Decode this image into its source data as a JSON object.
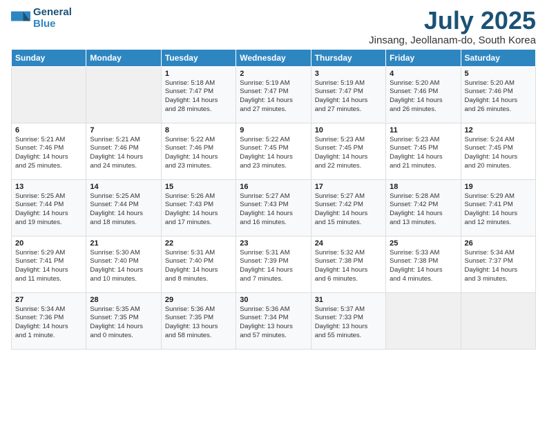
{
  "header": {
    "logo_line1": "General",
    "logo_line2": "Blue",
    "month_title": "July 2025",
    "location": "Jinsang, Jeollanam-do, South Korea"
  },
  "weekdays": [
    "Sunday",
    "Monday",
    "Tuesday",
    "Wednesday",
    "Thursday",
    "Friday",
    "Saturday"
  ],
  "weeks": [
    [
      {
        "day": "",
        "info": ""
      },
      {
        "day": "",
        "info": ""
      },
      {
        "day": "1",
        "info": "Sunrise: 5:18 AM\nSunset: 7:47 PM\nDaylight: 14 hours\nand 28 minutes."
      },
      {
        "day": "2",
        "info": "Sunrise: 5:19 AM\nSunset: 7:47 PM\nDaylight: 14 hours\nand 27 minutes."
      },
      {
        "day": "3",
        "info": "Sunrise: 5:19 AM\nSunset: 7:47 PM\nDaylight: 14 hours\nand 27 minutes."
      },
      {
        "day": "4",
        "info": "Sunrise: 5:20 AM\nSunset: 7:46 PM\nDaylight: 14 hours\nand 26 minutes."
      },
      {
        "day": "5",
        "info": "Sunrise: 5:20 AM\nSunset: 7:46 PM\nDaylight: 14 hours\nand 26 minutes."
      }
    ],
    [
      {
        "day": "6",
        "info": "Sunrise: 5:21 AM\nSunset: 7:46 PM\nDaylight: 14 hours\nand 25 minutes."
      },
      {
        "day": "7",
        "info": "Sunrise: 5:21 AM\nSunset: 7:46 PM\nDaylight: 14 hours\nand 24 minutes."
      },
      {
        "day": "8",
        "info": "Sunrise: 5:22 AM\nSunset: 7:46 PM\nDaylight: 14 hours\nand 23 minutes."
      },
      {
        "day": "9",
        "info": "Sunrise: 5:22 AM\nSunset: 7:45 PM\nDaylight: 14 hours\nand 23 minutes."
      },
      {
        "day": "10",
        "info": "Sunrise: 5:23 AM\nSunset: 7:45 PM\nDaylight: 14 hours\nand 22 minutes."
      },
      {
        "day": "11",
        "info": "Sunrise: 5:23 AM\nSunset: 7:45 PM\nDaylight: 14 hours\nand 21 minutes."
      },
      {
        "day": "12",
        "info": "Sunrise: 5:24 AM\nSunset: 7:45 PM\nDaylight: 14 hours\nand 20 minutes."
      }
    ],
    [
      {
        "day": "13",
        "info": "Sunrise: 5:25 AM\nSunset: 7:44 PM\nDaylight: 14 hours\nand 19 minutes."
      },
      {
        "day": "14",
        "info": "Sunrise: 5:25 AM\nSunset: 7:44 PM\nDaylight: 14 hours\nand 18 minutes."
      },
      {
        "day": "15",
        "info": "Sunrise: 5:26 AM\nSunset: 7:43 PM\nDaylight: 14 hours\nand 17 minutes."
      },
      {
        "day": "16",
        "info": "Sunrise: 5:27 AM\nSunset: 7:43 PM\nDaylight: 14 hours\nand 16 minutes."
      },
      {
        "day": "17",
        "info": "Sunrise: 5:27 AM\nSunset: 7:42 PM\nDaylight: 14 hours\nand 15 minutes."
      },
      {
        "day": "18",
        "info": "Sunrise: 5:28 AM\nSunset: 7:42 PM\nDaylight: 14 hours\nand 13 minutes."
      },
      {
        "day": "19",
        "info": "Sunrise: 5:29 AM\nSunset: 7:41 PM\nDaylight: 14 hours\nand 12 minutes."
      }
    ],
    [
      {
        "day": "20",
        "info": "Sunrise: 5:29 AM\nSunset: 7:41 PM\nDaylight: 14 hours\nand 11 minutes."
      },
      {
        "day": "21",
        "info": "Sunrise: 5:30 AM\nSunset: 7:40 PM\nDaylight: 14 hours\nand 10 minutes."
      },
      {
        "day": "22",
        "info": "Sunrise: 5:31 AM\nSunset: 7:40 PM\nDaylight: 14 hours\nand 8 minutes."
      },
      {
        "day": "23",
        "info": "Sunrise: 5:31 AM\nSunset: 7:39 PM\nDaylight: 14 hours\nand 7 minutes."
      },
      {
        "day": "24",
        "info": "Sunrise: 5:32 AM\nSunset: 7:38 PM\nDaylight: 14 hours\nand 6 minutes."
      },
      {
        "day": "25",
        "info": "Sunrise: 5:33 AM\nSunset: 7:38 PM\nDaylight: 14 hours\nand 4 minutes."
      },
      {
        "day": "26",
        "info": "Sunrise: 5:34 AM\nSunset: 7:37 PM\nDaylight: 14 hours\nand 3 minutes."
      }
    ],
    [
      {
        "day": "27",
        "info": "Sunrise: 5:34 AM\nSunset: 7:36 PM\nDaylight: 14 hours\nand 1 minute."
      },
      {
        "day": "28",
        "info": "Sunrise: 5:35 AM\nSunset: 7:35 PM\nDaylight: 14 hours\nand 0 minutes."
      },
      {
        "day": "29",
        "info": "Sunrise: 5:36 AM\nSunset: 7:35 PM\nDaylight: 13 hours\nand 58 minutes."
      },
      {
        "day": "30",
        "info": "Sunrise: 5:36 AM\nSunset: 7:34 PM\nDaylight: 13 hours\nand 57 minutes."
      },
      {
        "day": "31",
        "info": "Sunrise: 5:37 AM\nSunset: 7:33 PM\nDaylight: 13 hours\nand 55 minutes."
      },
      {
        "day": "",
        "info": ""
      },
      {
        "day": "",
        "info": ""
      }
    ]
  ]
}
